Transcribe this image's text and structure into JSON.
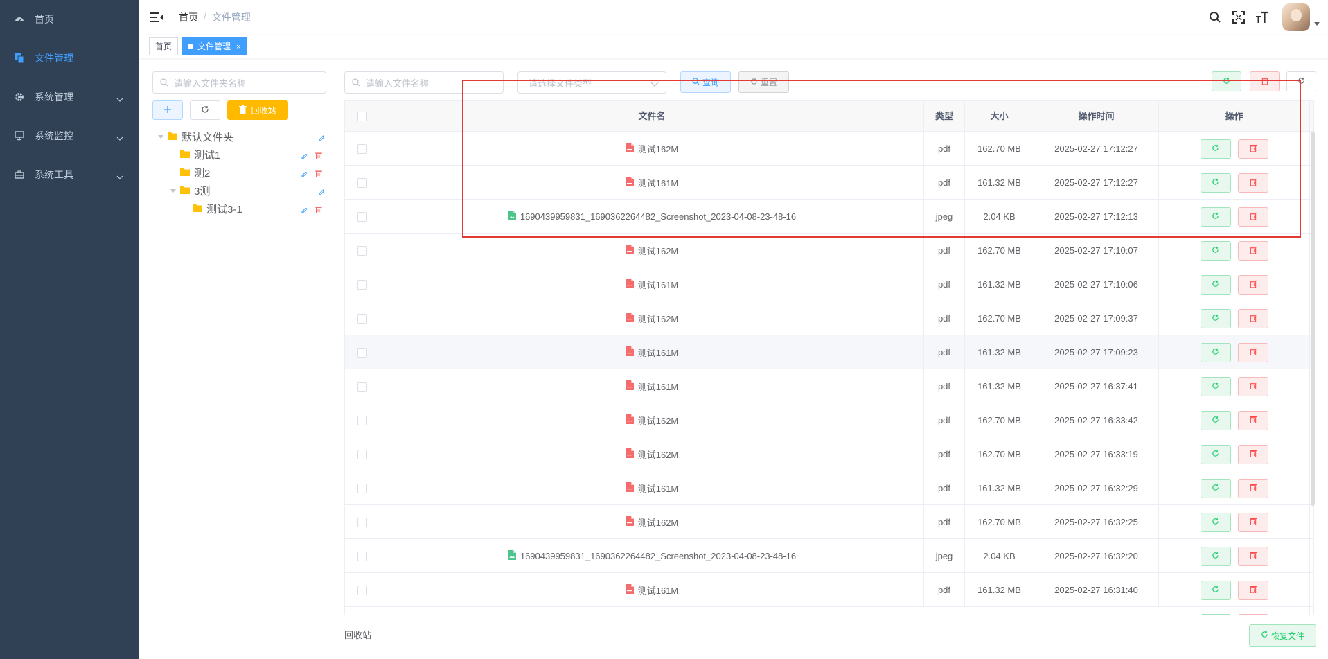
{
  "colors": {
    "sidebar_bg": "#304156",
    "sidebar_text": "#bfcbd9",
    "accent": "#409eff",
    "folder": "#ffc107",
    "pdf_icon": "#f56c6c",
    "image_icon": "#4cc48b",
    "success": "#13ce66",
    "danger": "#ff4949",
    "highlight": "#e53935"
  },
  "sidebar": {
    "items": [
      {
        "label": "首页",
        "icon": "dashboard-icon",
        "active": false,
        "expandable": false
      },
      {
        "label": "文件管理",
        "icon": "file-copy-icon",
        "active": true,
        "expandable": false
      },
      {
        "label": "系统管理",
        "icon": "gear-icon",
        "active": false,
        "expandable": true
      },
      {
        "label": "系统监控",
        "icon": "monitor-icon",
        "active": false,
        "expandable": true
      },
      {
        "label": "系统工具",
        "icon": "toolbox-icon",
        "active": false,
        "expandable": true
      }
    ]
  },
  "navbar": {
    "breadcrumb": {
      "home": "首页",
      "separator": "/",
      "current": "文件管理"
    },
    "right_icons": [
      "search-icon",
      "fullscreen-icon",
      "font-size-icon"
    ]
  },
  "tags": [
    {
      "label": "首页",
      "active": false
    },
    {
      "label": "文件管理",
      "active": true,
      "close": "×"
    }
  ],
  "left": {
    "folder_search_placeholder": "请输入文件夹名称",
    "recycle_label": "回收站",
    "tree": [
      {
        "label": "默认文件夹",
        "level": 0,
        "expanded": true,
        "deletable": false
      },
      {
        "label": "测试1",
        "level": 1,
        "expanded": false,
        "deletable": true
      },
      {
        "label": "测2",
        "level": 1,
        "expanded": false,
        "deletable": true
      },
      {
        "label": "3测",
        "level": 1,
        "expanded": true,
        "deletable": false
      },
      {
        "label": "测试3-1",
        "level": 2,
        "expanded": false,
        "deletable": true
      }
    ]
  },
  "toolbar": {
    "file_search_placeholder": "请输入文件名称",
    "type_select_placeholder": "请选择文件类型",
    "query_label": "查询",
    "reset_label": "重置"
  },
  "table": {
    "headers": {
      "name": "文件名",
      "type": "类型",
      "size": "大小",
      "time": "操作时间",
      "ops": "操作"
    },
    "rows": [
      {
        "name": "测试162M",
        "type": "pdf",
        "size": "162.70 MB",
        "time": "2025-02-27 17:12:27"
      },
      {
        "name": "测试161M",
        "type": "pdf",
        "size": "161.32 MB",
        "time": "2025-02-27 17:12:27"
      },
      {
        "name": "1690439959831_1690362264482_Screenshot_2023-04-08-23-48-16",
        "type": "jpeg",
        "size": "2.04 KB",
        "time": "2025-02-27 17:12:13"
      },
      {
        "name": "测试162M",
        "type": "pdf",
        "size": "162.70 MB",
        "time": "2025-02-27 17:10:07"
      },
      {
        "name": "测试161M",
        "type": "pdf",
        "size": "161.32 MB",
        "time": "2025-02-27 17:10:06"
      },
      {
        "name": "测试162M",
        "type": "pdf",
        "size": "162.70 MB",
        "time": "2025-02-27 17:09:37"
      },
      {
        "name": "测试161M",
        "type": "pdf",
        "size": "161.32 MB",
        "time": "2025-02-27 17:09:23"
      },
      {
        "name": "测试161M",
        "type": "pdf",
        "size": "161.32 MB",
        "time": "2025-02-27 16:37:41"
      },
      {
        "name": "测试162M",
        "type": "pdf",
        "size": "162.70 MB",
        "time": "2025-02-27 16:33:42"
      },
      {
        "name": "测试162M",
        "type": "pdf",
        "size": "162.70 MB",
        "time": "2025-02-27 16:33:19"
      },
      {
        "name": "测试161M",
        "type": "pdf",
        "size": "161.32 MB",
        "time": "2025-02-27 16:32:29"
      },
      {
        "name": "测试162M",
        "type": "pdf",
        "size": "162.70 MB",
        "time": "2025-02-27 16:32:25"
      },
      {
        "name": "1690439959831_1690362264482_Screenshot_2023-04-08-23-48-16",
        "type": "jpeg",
        "size": "2.04 KB",
        "time": "2025-02-27 16:32:20"
      },
      {
        "name": "测试161M",
        "type": "pdf",
        "size": "161.32 MB",
        "time": "2025-02-27 16:31:40"
      }
    ]
  },
  "footer": {
    "label": "回收站",
    "restore_label": "恢复文件"
  }
}
